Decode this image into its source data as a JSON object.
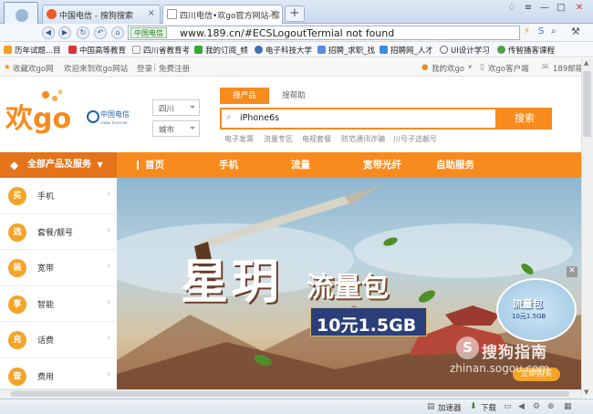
{
  "browser": {
    "tabs": [
      {
        "label": "中国电信 - 搜狗搜索",
        "active": false
      },
      {
        "label": "四川电信•欢go官方网站-综",
        "active": true
      }
    ],
    "url_badge": "中国电信",
    "url": "www.189.cn/#ECSLogoutTermial not found",
    "bookmarks": [
      "历年试题...目",
      "中国高等教育",
      "四川省教育考",
      "我的订阅_频",
      "电子科技大学",
      "招聘_求职_找",
      "招聘网_人才",
      "UI设计学习",
      "传智播客课程"
    ]
  },
  "site": {
    "top_links": {
      "favorite": "收藏欢go网",
      "welcome": "欢迎来到欢go网站",
      "login": "登录",
      "register": "免费注册",
      "my": "我的欢go",
      "client": "欢go客户端",
      "mail": "189邮箱"
    },
    "logo_text": "欢go",
    "telecom_text": "中国电信",
    "telecom_en": "CHINA TELECOM",
    "region": "四川",
    "city": "城市",
    "search_tabs": [
      "搜产品",
      "搜帮助"
    ],
    "search_value": "iPhone6s",
    "search_button": "搜索",
    "hot_keywords": [
      "电子发票",
      "流量专区",
      "电视套餐",
      "防范通讯诈骗",
      "川号子选靓号"
    ],
    "all_products": "全部产品及服务",
    "menu": [
      "首页",
      "手机",
      "流量",
      "宽带光纤",
      "自助服务"
    ],
    "categories": [
      {
        "icon": "买",
        "label": "手机"
      },
      {
        "icon": "选",
        "label": "套餐/靓号"
      },
      {
        "icon": "装",
        "label": "宽带"
      },
      {
        "icon": "享",
        "label": "智能"
      },
      {
        "icon": "充",
        "label": "话费"
      },
      {
        "icon": "查",
        "label": "费用"
      }
    ],
    "banner": {
      "title_big": "星玥",
      "title_sub": "流量包",
      "price": "10元1.5GB",
      "ad_title": "流量包",
      "ad_price": "10元1.5GB",
      "ad_button": "立即购买"
    }
  },
  "watermark": {
    "brand": "搜狗指南",
    "domain": "zhinan.sogou.com"
  },
  "status": {
    "accelerator": "加速器",
    "download": "下载"
  }
}
